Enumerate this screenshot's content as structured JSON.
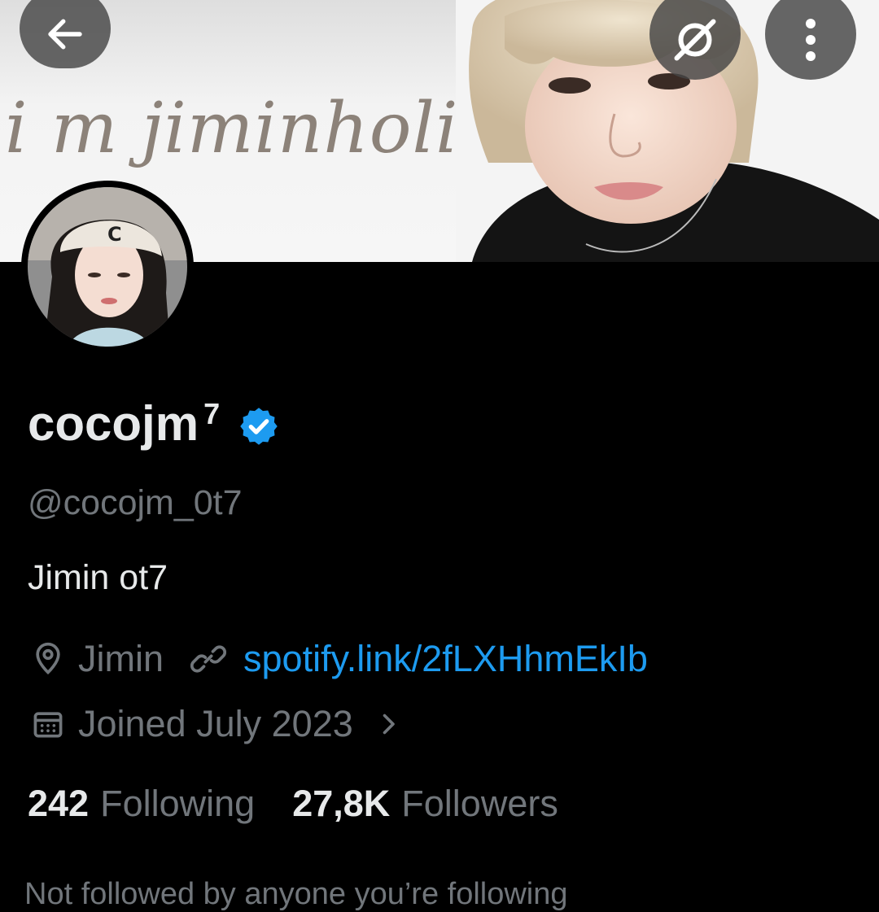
{
  "banner": {
    "script_text": "i m jiminholic"
  },
  "header": {
    "back_icon": "arrow-left-icon",
    "grok_icon": "grok-icon",
    "more_icon": "more-vertical-icon"
  },
  "profile": {
    "display_name": "cocojm",
    "display_name_sup": "7",
    "verified_icon": "verified-badge-icon",
    "handle": "@cocojm_0t7",
    "bio": "Jimin ot7",
    "location_icon": "location-pin-icon",
    "location": "Jimin",
    "link_icon": "link-icon",
    "link": "spotify.link/2fLXHhmEkIb",
    "calendar_icon": "calendar-icon",
    "joined": "Joined July 2023",
    "joined_chevron_icon": "chevron-right-icon"
  },
  "stats": {
    "following_count": "242",
    "following_label": "Following",
    "followers_count": "27,8K",
    "followers_label": "Followers"
  },
  "mutuals_text": "Not followed by anyone you’re following",
  "colors": {
    "background": "#000000",
    "primary_text": "#e7e9ea",
    "secondary_text": "#71767b",
    "accent": "#1d9bf0"
  }
}
